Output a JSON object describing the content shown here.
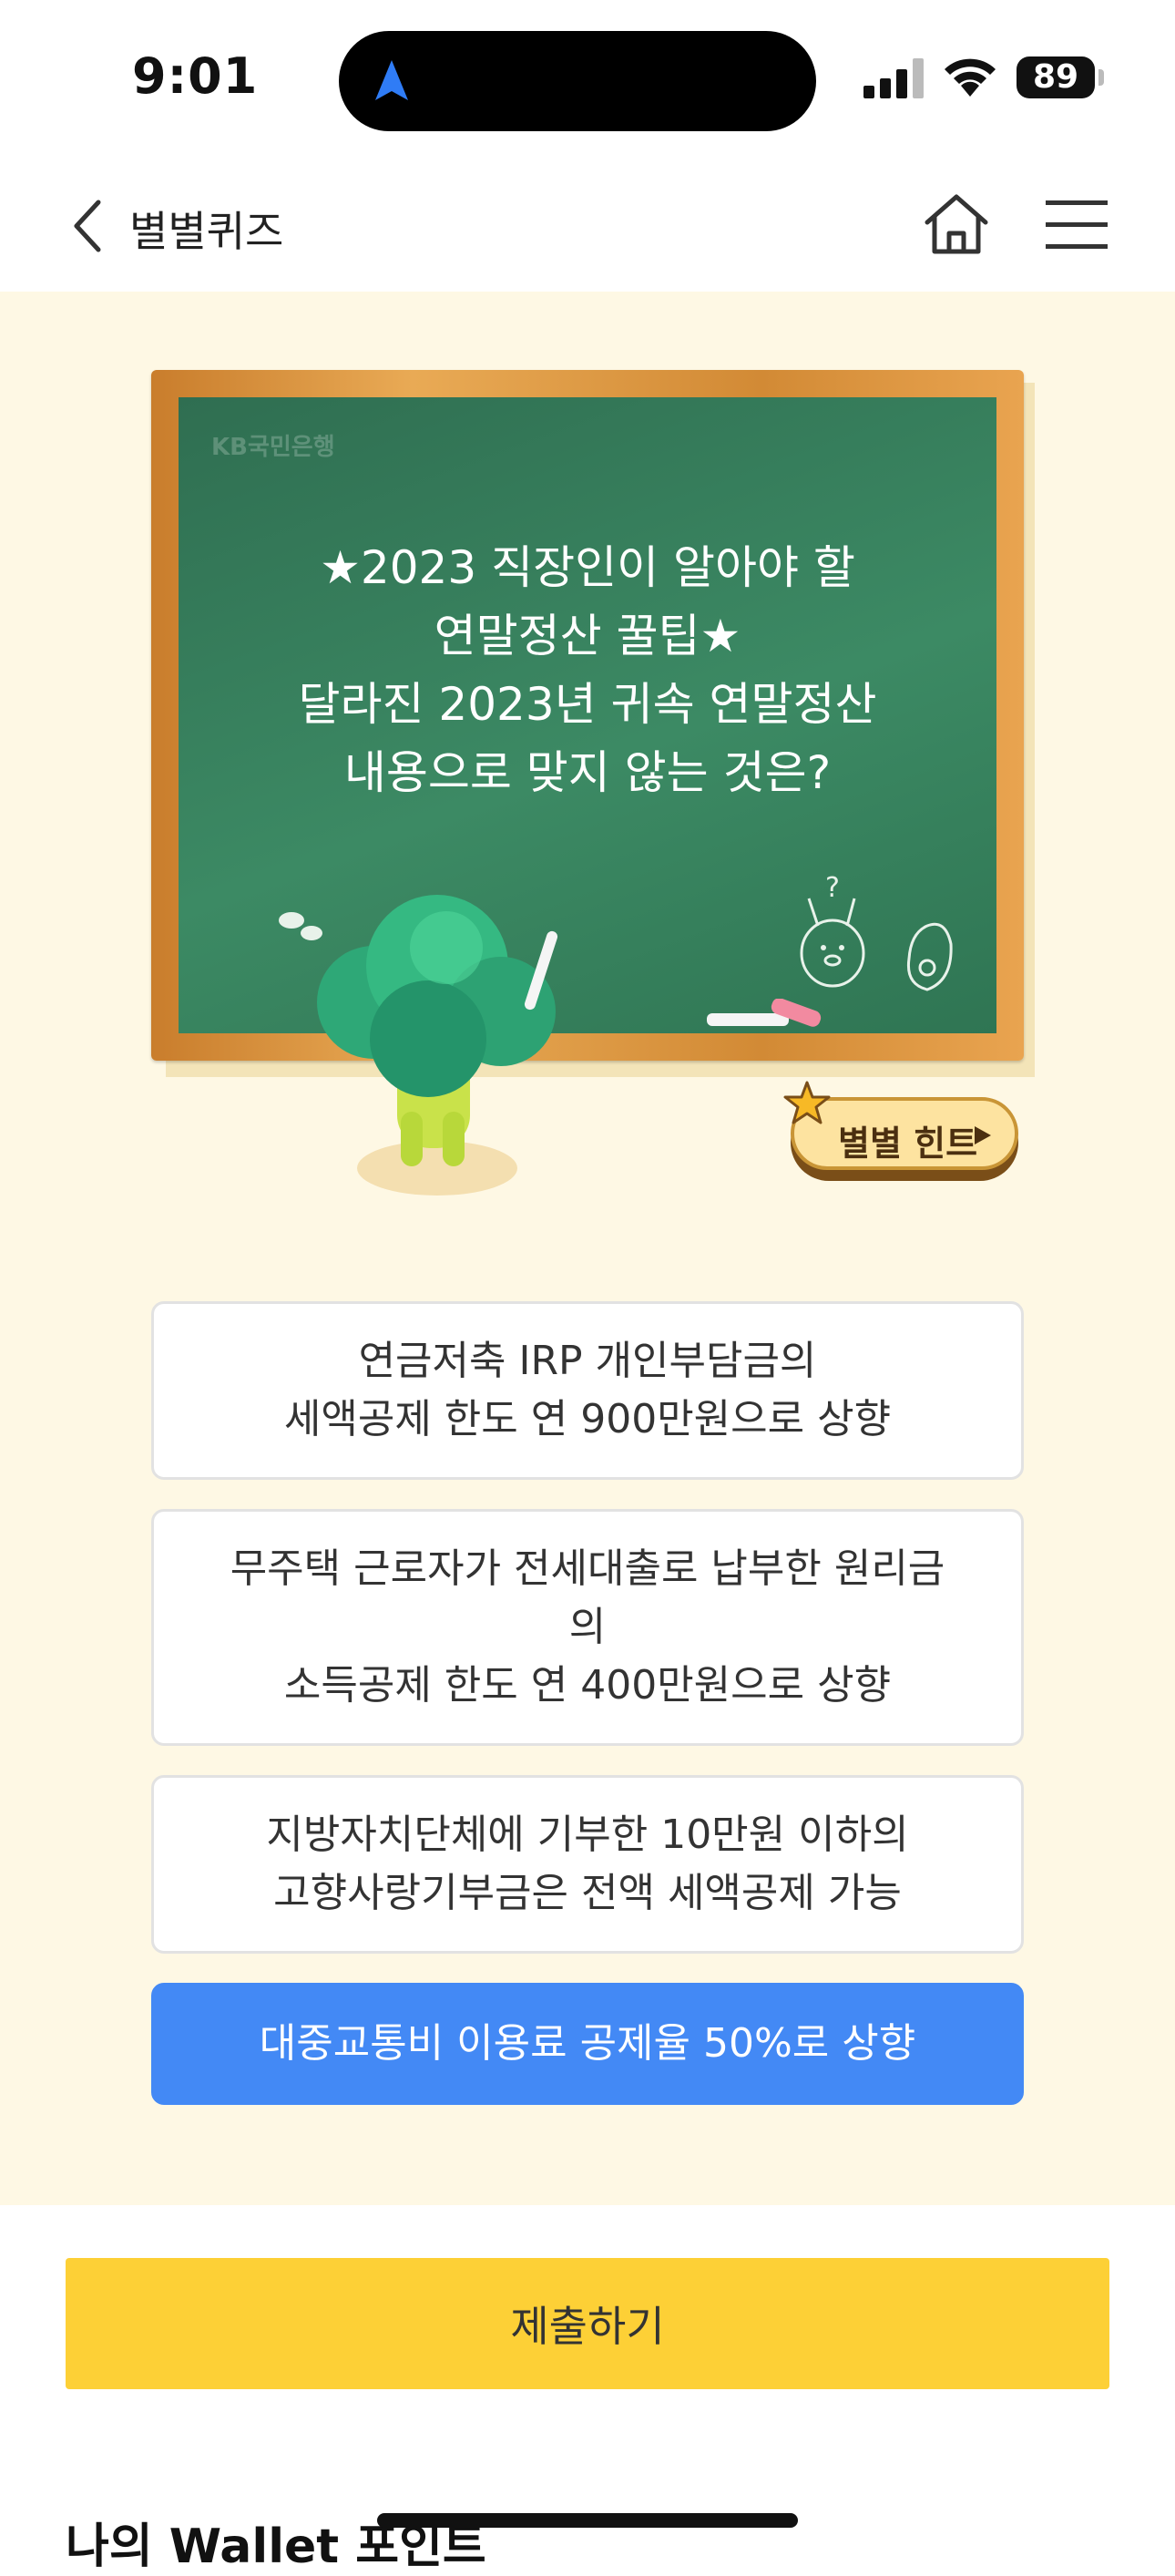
{
  "status_bar": {
    "time": "9:01",
    "battery": "89"
  },
  "header": {
    "back_icon": "chevron-left-icon",
    "title": "별별퀴즈",
    "home_icon": "home-icon",
    "menu_icon": "hamburger-menu-icon"
  },
  "quiz": {
    "board_logo": "KB국민은행",
    "question_lines": [
      "★2023 직장인이 알아야 할",
      "연말정산 꿀팁★",
      "달라진 2023년 귀속 연말정산",
      "내용으로 맞지 않는 것은?"
    ],
    "hint_label": "별별 힌트",
    "options": [
      {
        "lines": [
          "연금저축 IRP 개인부담금의",
          "세액공제 한도 연 900만원으로 상향"
        ],
        "selected": false
      },
      {
        "lines": [
          "무주택 근로자가 전세대출로 납부한 원리금",
          "의",
          "소득공제 한도 연 400만원으로 상향"
        ],
        "selected": false
      },
      {
        "lines": [
          "지방자치단체에 기부한 10만원 이하의",
          "고향사랑기부금은 전액 세액공제 가능"
        ],
        "selected": false
      },
      {
        "lines": [
          "대중교통비 이용료 공제율 50%로 상향"
        ],
        "selected": true
      }
    ]
  },
  "submit_label": "제출하기",
  "wallet_title": "나의 Wallet 포인트",
  "colors": {
    "background": "#fef8e4",
    "selected": "#4389f5",
    "submit": "#fdd036",
    "board": "#357d5a"
  }
}
